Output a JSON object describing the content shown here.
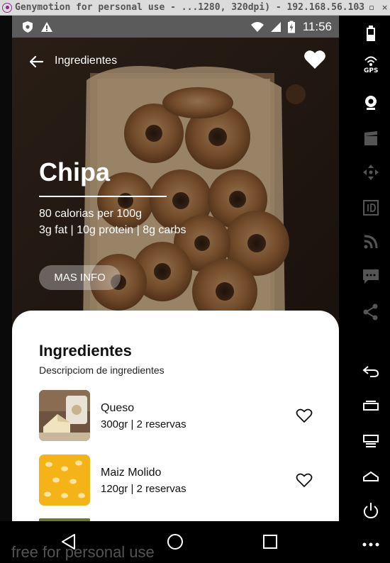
{
  "window": {
    "title": "Genymotion for personal use - ...1280, 320dpi) - 192.168.56.103",
    "controls": [
      "-",
      "▫",
      "×"
    ]
  },
  "status_bar": {
    "time": "11:56",
    "icons": [
      "shield-icon",
      "warning-icon",
      "wifi-icon",
      "signal-icon",
      "battery-icon"
    ]
  },
  "app_bar": {
    "title": "Ingredientes",
    "back_icon": "arrow-left-icon",
    "favorite_icon": "heart-filled-icon"
  },
  "dish": {
    "name": "Chipa",
    "calories": "80 calorias per 100gr",
    "calories_display": "80 calorias per 100g",
    "macros": "3g fat | 10g protein | 8g carbs",
    "more_button": "MAS INFO"
  },
  "ingredients": {
    "title": "Ingredientes",
    "subtitle": "Descripciom de ingredientes",
    "items": [
      {
        "name": "Queso",
        "meta": "300gr | 2 reservas",
        "favorite": false
      },
      {
        "name": "Maiz Molido",
        "meta": "120gr | 2 reservas",
        "favorite": false
      }
    ]
  },
  "nav": {
    "buttons": [
      "back-triangle-icon",
      "home-circle-icon",
      "recents-square-icon"
    ]
  },
  "watermark": "free for personal use",
  "side_panel": {
    "gps_label": "GPS",
    "icons": [
      "battery-icon",
      "gps-icon",
      "webcam-icon",
      "clapper-icon",
      "move-icon",
      "id-icon",
      "rss-icon",
      "chat-icon",
      "share-icon",
      "back-icon",
      "recents-icon",
      "menu-icon",
      "home-icon",
      "power-icon",
      "more-icon"
    ]
  },
  "colors": {
    "status_bar": "#5b5b5b",
    "sheet": "#ffffff",
    "overlay_button": "rgba(255,255,255,0.32)",
    "cheese": "#efe3c0",
    "corn": "#f4b418"
  }
}
